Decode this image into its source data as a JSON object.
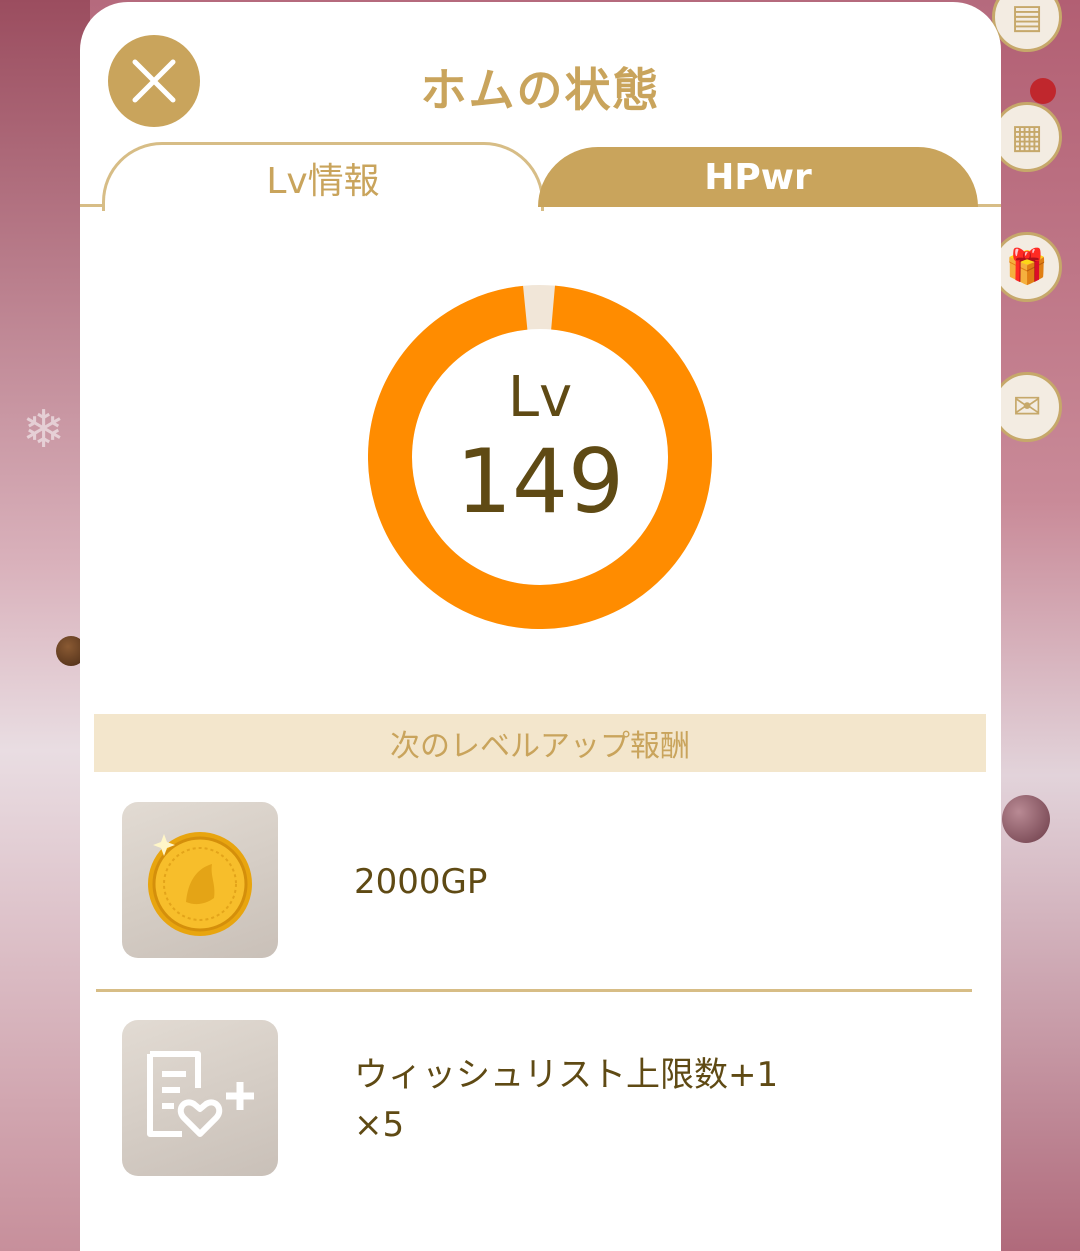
{
  "modal": {
    "title": "ホムの状態",
    "close_icon": "close-icon"
  },
  "tabs": [
    {
      "label": "Lv情報",
      "active": true
    },
    {
      "label": "HPwr",
      "active": false
    }
  ],
  "level": {
    "label": "Lv",
    "value": "149",
    "progress_fraction": 0.97
  },
  "rewards": {
    "header": "次のレベルアップ報酬",
    "items": [
      {
        "icon": "gold-coin-icon",
        "text": "2000GP"
      },
      {
        "icon": "wishlist-plus-icon",
        "text": "ウィッシュリスト上限数+1",
        "quantity": "×5"
      }
    ]
  },
  "colors": {
    "accent_gold": "#c9a45c",
    "ring_orange": "#ff8c00",
    "ring_track": "#f1e6d8",
    "text_brown": "#5f4a14"
  }
}
